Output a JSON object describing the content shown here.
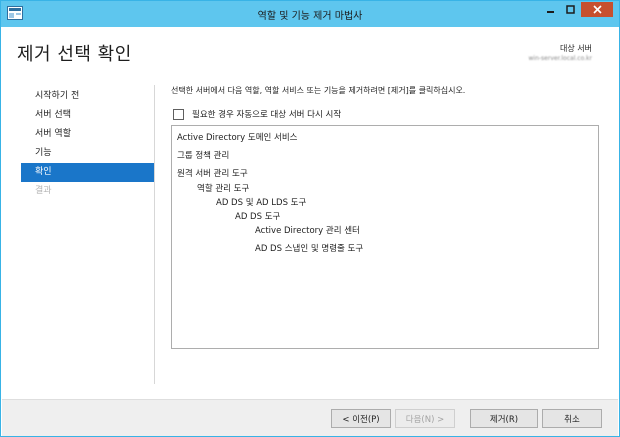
{
  "window": {
    "title": "역할 및 기능 제거 마법사",
    "accent_color": "#5ec6ee",
    "close_color": "#c7502e"
  },
  "header": {
    "page_title": "제거 선택 확인",
    "target_server_label": "대상 서버",
    "target_server_value": "win-server.local.co.kr"
  },
  "sidebar": {
    "items": [
      {
        "label": "시작하기 전",
        "state": "normal"
      },
      {
        "label": "서버 선택",
        "state": "normal"
      },
      {
        "label": "서버 역할",
        "state": "normal"
      },
      {
        "label": "기능",
        "state": "normal"
      },
      {
        "label": "확인",
        "state": "active"
      },
      {
        "label": "결과",
        "state": "disabled"
      }
    ],
    "active_color": "#1a76c9"
  },
  "main": {
    "instruction": "선택한 서버에서 다음 역할, 역할 서비스 또는 기능을 제거하려면 [제거]를 클릭하십시오.",
    "restart_checkbox_label": "필요한 경우 자동으로 대상 서버 다시 시작",
    "restart_checked": false,
    "items": [
      {
        "label": "Active Directory 도메인 서비스",
        "level": 0
      },
      {
        "label": "그룹 정책 관리",
        "level": 0
      },
      {
        "label": "원격 서버 관리 도구",
        "level": 0
      },
      {
        "label": "역할 관리 도구",
        "level": 1
      },
      {
        "label": "AD DS 및 AD LDS 도구",
        "level": 2
      },
      {
        "label": "AD DS 도구",
        "level": 3
      },
      {
        "label": "Active Directory 관리 센터",
        "level": 4
      },
      {
        "label": "AD DS 스냅인 및 명령줄 도구",
        "level": 4
      }
    ]
  },
  "footer": {
    "prev_label": "< 이전(P)",
    "next_label": "다음(N) >",
    "remove_label": "제거(R)",
    "cancel_label": "취소",
    "next_enabled": false
  }
}
